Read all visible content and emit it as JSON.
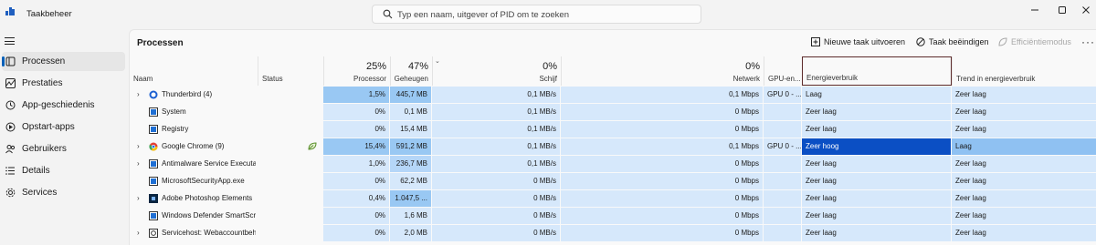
{
  "app": {
    "title": "Taakbeheer"
  },
  "search": {
    "placeholder": "Typ een naam, uitgever of PID om te zoeken"
  },
  "sidebar": {
    "items": [
      {
        "label": "Processen",
        "icon": "processes-icon",
        "active": true
      },
      {
        "label": "Prestaties",
        "icon": "performance-icon"
      },
      {
        "label": "App-geschiedenis",
        "icon": "history-icon"
      },
      {
        "label": "Opstart-apps",
        "icon": "startup-icon"
      },
      {
        "label": "Gebruikers",
        "icon": "users-icon"
      },
      {
        "label": "Details",
        "icon": "details-icon"
      },
      {
        "label": "Services",
        "icon": "services-icon"
      }
    ]
  },
  "page": {
    "title": "Processen"
  },
  "toolbar": {
    "new_task": "Nieuwe taak uitvoeren",
    "end_task": "Taak beëindigen",
    "efficiency": "Efficiëntiemodus"
  },
  "columns": {
    "name": "Naam",
    "status": "Status",
    "cpu": {
      "label": "Processor",
      "total": "25%"
    },
    "memory": {
      "label": "Geheugen",
      "total": "47%"
    },
    "disk": {
      "label": "Schijf",
      "total": "0%"
    },
    "network": {
      "label": "Netwerk",
      "total": "0%"
    },
    "gpu_engine": {
      "label": "GPU-en..."
    },
    "power": {
      "label": "Energieverbruik"
    },
    "power_trend": {
      "label": "Trend in energieverbruik"
    }
  },
  "colors": {
    "cell_light": "#d6e8fb",
    "cell_mid": "#b5d6f8",
    "cell_strong": "#99c8f3",
    "power_high": "#0b4fc4",
    "power_trend_high": "#8fc1f2"
  },
  "rows": [
    {
      "expandable": true,
      "icon": "thunderbird-icon",
      "name": "Thunderbird (4)",
      "status_icon": false,
      "cpu": "1,5%",
      "memory": "445,7 MB",
      "disk": "0,1 MB/s",
      "network": "0,1 Mbps",
      "gpu": "GPU 0 - ...",
      "power": "Laag",
      "trend": "Zeer laag",
      "cpu_shade": "strong",
      "mem_shade": "strong",
      "power_level": "low"
    },
    {
      "expandable": false,
      "icon": "system-icon",
      "name": "System",
      "status_icon": false,
      "cpu": "0%",
      "memory": "0,1 MB",
      "disk": "0,1 MB/s",
      "network": "0 Mbps",
      "gpu": "",
      "power": "Zeer laag",
      "trend": "Zeer laag",
      "cpu_shade": "light",
      "mem_shade": "light",
      "power_level": "very-low"
    },
    {
      "expandable": false,
      "icon": "registry-icon",
      "name": "Registry",
      "status_icon": false,
      "cpu": "0%",
      "memory": "15,4 MB",
      "disk": "0,1 MB/s",
      "network": "0 Mbps",
      "gpu": "",
      "power": "Zeer laag",
      "trend": "Zeer laag",
      "cpu_shade": "light",
      "mem_shade": "light",
      "power_level": "very-low"
    },
    {
      "expandable": true,
      "icon": "chrome-icon",
      "name": "Google Chrome (9)",
      "status_icon": true,
      "cpu": "15,4%",
      "memory": "591,2 MB",
      "disk": "0,1 MB/s",
      "network": "0,1 Mbps",
      "gpu": "GPU 0 - ...",
      "power": "Zeer hoog",
      "trend": "Laag",
      "cpu_shade": "strong",
      "mem_shade": "strong",
      "power_level": "very-high"
    },
    {
      "expandable": true,
      "icon": "antimalware-icon",
      "name": "Antimalware Service Executable",
      "status_icon": false,
      "cpu": "1,0%",
      "memory": "236,7 MB",
      "disk": "0,1 MB/s",
      "network": "0 Mbps",
      "gpu": "",
      "power": "Zeer laag",
      "trend": "Zeer laag",
      "cpu_shade": "light",
      "mem_shade": "mid",
      "power_level": "very-low"
    },
    {
      "expandable": false,
      "icon": "security-app-icon",
      "name": "MicrosoftSecurityApp.exe",
      "status_icon": false,
      "cpu": "0%",
      "memory": "62,2 MB",
      "disk": "0 MB/s",
      "network": "0 Mbps",
      "gpu": "",
      "power": "Zeer laag",
      "trend": "Zeer laag",
      "cpu_shade": "light",
      "mem_shade": "light",
      "power_level": "very-low"
    },
    {
      "expandable": true,
      "icon": "photoshop-icon",
      "name": "Adobe Photoshop Elements",
      "status_icon": false,
      "cpu": "0,4%",
      "memory": "1.047,5 ...",
      "disk": "0 MB/s",
      "network": "0 Mbps",
      "gpu": "",
      "power": "Zeer laag",
      "trend": "Zeer laag",
      "cpu_shade": "light",
      "mem_shade": "strong",
      "power_level": "very-low"
    },
    {
      "expandable": false,
      "icon": "defender-icon",
      "name": "Windows Defender SmartScreen",
      "status_icon": false,
      "cpu": "0%",
      "memory": "1,6 MB",
      "disk": "0 MB/s",
      "network": "0 Mbps",
      "gpu": "",
      "power": "Zeer laag",
      "trend": "Zeer laag",
      "cpu_shade": "light",
      "mem_shade": "light",
      "power_level": "very-low"
    },
    {
      "expandable": true,
      "icon": "servicehost-icon",
      "name": "Servicehost: Webaccountbeheer",
      "status_icon": false,
      "cpu": "0%",
      "memory": "2,0 MB",
      "disk": "0 MB/s",
      "network": "0 Mbps",
      "gpu": "",
      "power": "Zeer laag",
      "trend": "Zeer laag",
      "cpu_shade": "light",
      "mem_shade": "light",
      "power_level": "very-low"
    }
  ]
}
